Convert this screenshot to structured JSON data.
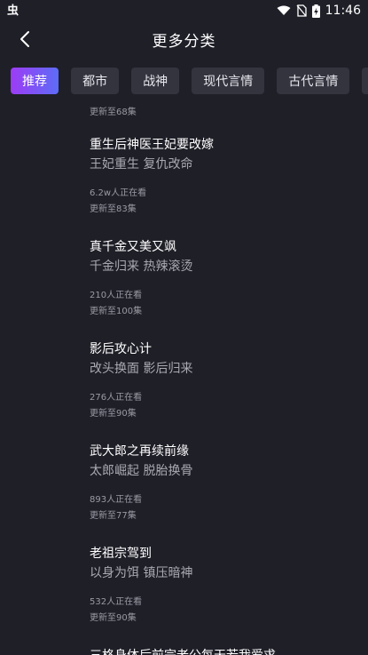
{
  "status": {
    "app_badge": "虫",
    "time": "11:46"
  },
  "header": {
    "title": "更多分类"
  },
  "tabs": [
    {
      "label": "推荐",
      "active": true
    },
    {
      "label": "都市",
      "active": false
    },
    {
      "label": "战神",
      "active": false
    },
    {
      "label": "现代言情",
      "active": false
    },
    {
      "label": "古代言情",
      "active": false
    }
  ],
  "list": {
    "top_meta": "更新至68集",
    "items": [
      {
        "title": "重生后神医王妃要改嫁",
        "tags": "王妃重生 复仇改命",
        "viewers": "6.2w人正在看",
        "episodes": "更新至83集"
      },
      {
        "title": "真千金又美又飒",
        "tags": "千金归来 热辣滚烫",
        "viewers": "210人正在看",
        "episodes": "更新至100集"
      },
      {
        "title": "影后攻心计",
        "tags": "改头换面 影后归来",
        "viewers": "276人正在看",
        "episodes": "更新至90集"
      },
      {
        "title": "武大郎之再续前缘",
        "tags": "太郎崛起 脱胎换骨",
        "viewers": "893人正在看",
        "episodes": "更新至77集"
      },
      {
        "title": "老祖宗驾到",
        "tags": "以身为饵 镇压暗神",
        "viewers": "532人正在看",
        "episodes": "更新至90集"
      },
      {
        "title": "三格身体后前宗老公每天若我爱求",
        "tags": "",
        "viewers": "",
        "episodes": ""
      }
    ]
  }
}
